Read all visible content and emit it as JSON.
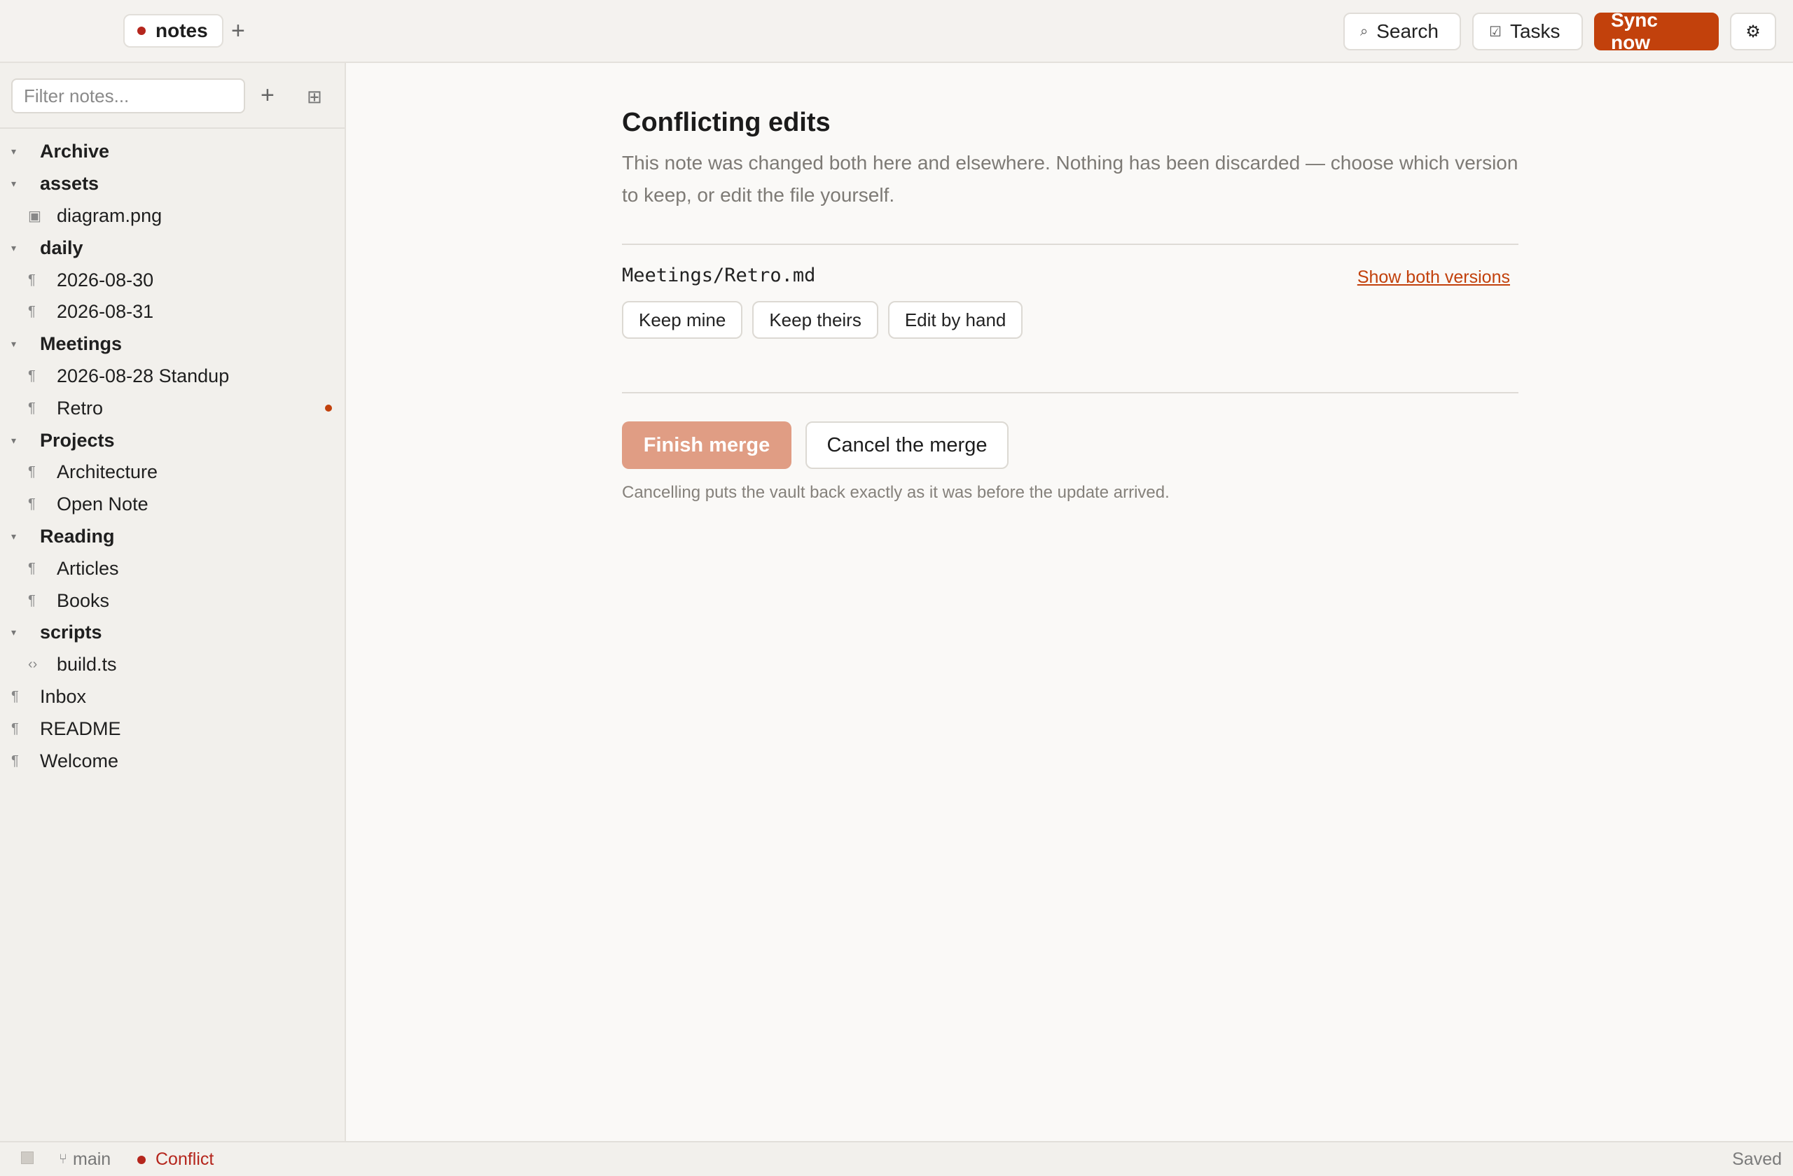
{
  "topbar": {
    "vault_tab": "notes",
    "add_tab_glyph": "+",
    "search_label": "Search",
    "search_icon": "⌕",
    "tasks_label": "Tasks",
    "tasks_icon": "☑",
    "sync_label": "Sync now",
    "settings_icon": "⚙"
  },
  "sidebar": {
    "filter_placeholder": "Filter notes...",
    "add_glyph": "+",
    "grid_glyph": "⊞",
    "tree": [
      {
        "type": "folder",
        "label": "Archive"
      },
      {
        "type": "folder",
        "label": "assets"
      },
      {
        "type": "child",
        "label": "diagram.png",
        "icon": "▣"
      },
      {
        "type": "folder",
        "label": "daily"
      },
      {
        "type": "child",
        "label": "2026-08-30",
        "icon": "¶"
      },
      {
        "type": "child",
        "label": "2026-08-31",
        "icon": "¶"
      },
      {
        "type": "folder",
        "label": "Meetings"
      },
      {
        "type": "child",
        "label": "2026-08-28 Standup",
        "icon": "¶"
      },
      {
        "type": "child",
        "label": "Retro",
        "icon": "¶",
        "modified": true
      },
      {
        "type": "folder",
        "label": "Projects"
      },
      {
        "type": "child",
        "label": "Architecture",
        "icon": "¶"
      },
      {
        "type": "child",
        "label": "Open Note",
        "icon": "¶"
      },
      {
        "type": "folder",
        "label": "Reading"
      },
      {
        "type": "child",
        "label": "Articles",
        "icon": "¶"
      },
      {
        "type": "child",
        "label": "Books",
        "icon": "¶"
      },
      {
        "type": "folder",
        "label": "scripts"
      },
      {
        "type": "child",
        "label": "build.ts",
        "icon": "‹›"
      },
      {
        "type": "root",
        "label": "Inbox",
        "icon": "¶"
      },
      {
        "type": "root",
        "label": "README",
        "icon": "¶"
      },
      {
        "type": "root",
        "label": "Welcome",
        "icon": "¶"
      }
    ]
  },
  "main": {
    "title": "Conflicting edits",
    "description": "This note was changed both here and elsewhere. Nothing has been discarded — choose which version to keep, or edit the file yourself.",
    "file_path": "Meetings/Retro.md",
    "show_both_label": "Show both versions",
    "keep_mine": "Keep mine",
    "keep_theirs": "Keep theirs",
    "edit_by_hand": "Edit by hand",
    "finish_label": "Finish merge",
    "cancel_label": "Cancel the merge",
    "cancel_note": "Cancelling puts the vault back exactly as it was before the update arrived."
  },
  "statusbar": {
    "branch_icon": "⑂",
    "branch": "main",
    "conflict": "Conflict",
    "saved": "Saved"
  },
  "colors": {
    "accent": "#c2410c",
    "conflict": "#b5261d",
    "finish_disabled": "#e09d84"
  }
}
